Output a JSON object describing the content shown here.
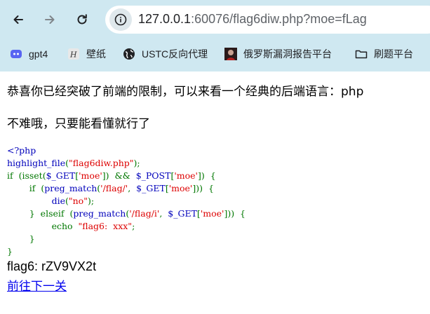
{
  "browser": {
    "url_prefix": "127.0.0.1",
    "url_rest": ":60076/flag6diw.php?moe=fLag",
    "bookmarks": [
      "gpt4",
      "壁纸",
      "USTC反向代理",
      "俄罗斯漏洞报告平台",
      "刷题平台"
    ]
  },
  "page": {
    "heading": "恭喜你已经突破了前端的限制，可以来看一个经典的后端语言：php",
    "subtitle": "不难哦，只要能看懂就行了",
    "code_lines": [
      [
        [
          "d",
          "<?php"
        ]
      ],
      [
        [
          "d",
          "highlight_file"
        ],
        [
          "k",
          "("
        ],
        [
          "s",
          "\"flag6diw.php\""
        ],
        [
          "k",
          ");"
        ]
      ],
      [
        [
          "k",
          "if  (isset("
        ],
        [
          "d",
          "$_GET"
        ],
        [
          "k",
          "["
        ],
        [
          "s",
          "'moe'"
        ],
        [
          "k",
          "])  &&  "
        ],
        [
          "d",
          "$_POST"
        ],
        [
          "k",
          "["
        ],
        [
          "s",
          "'moe'"
        ],
        [
          "k",
          "])  {"
        ]
      ],
      [
        [
          "k",
          "        if  ("
        ],
        [
          "d",
          "preg_match"
        ],
        [
          "k",
          "("
        ],
        [
          "s",
          "'/flag/'"
        ],
        [
          "k",
          ",  "
        ],
        [
          "d",
          "$_GET"
        ],
        [
          "k",
          "["
        ],
        [
          "s",
          "'moe'"
        ],
        [
          "k",
          "]))  {"
        ]
      ],
      [
        [
          "k",
          "                "
        ],
        [
          "d",
          "die"
        ],
        [
          "k",
          "("
        ],
        [
          "s",
          "\"no\""
        ],
        [
          "k",
          ");"
        ]
      ],
      [
        [
          "k",
          "        }  elseif  ("
        ],
        [
          "d",
          "preg_match"
        ],
        [
          "k",
          "("
        ],
        [
          "s",
          "'/flag/i'"
        ],
        [
          "k",
          ",  "
        ],
        [
          "d",
          "$_GET"
        ],
        [
          "k",
          "["
        ],
        [
          "s",
          "'moe'"
        ],
        [
          "k",
          "]))  {"
        ]
      ],
      [
        [
          "k",
          "                echo  "
        ],
        [
          "s",
          "\"flag6:  xxx\""
        ],
        [
          "k",
          ";"
        ]
      ],
      [
        [
          "k",
          "        }"
        ]
      ],
      [
        [
          "k",
          "}"
        ]
      ]
    ],
    "flag_text": "flag6: rZV9VX2t",
    "next_link": "前往下一关"
  }
}
